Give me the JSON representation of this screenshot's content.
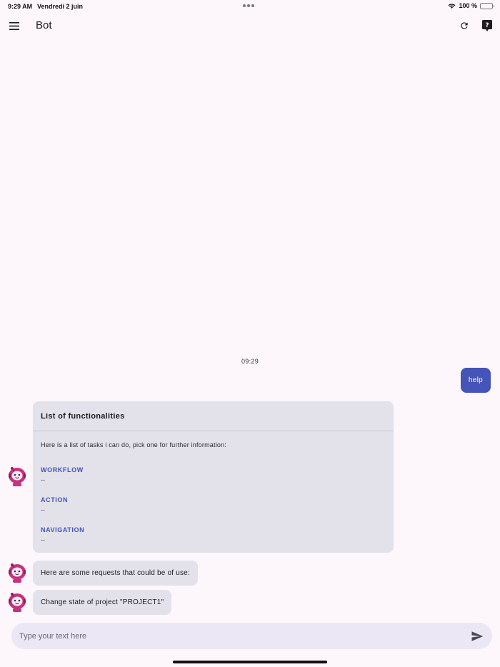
{
  "status_bar": {
    "time": "9:29 AM",
    "date": "Vendredi 2 juin",
    "battery": "100 %"
  },
  "app_bar": {
    "title": "Bot",
    "icons": [
      "menu-icon",
      "refresh-icon",
      "help-icon"
    ]
  },
  "chat": {
    "timestamp": "09:29",
    "user_message": "help",
    "card": {
      "title": "List of functionalities",
      "intro": "Here is a list of tasks i can do, pick one for further information:",
      "items": [
        {
          "name": "WORKFLOW",
          "desc": "--"
        },
        {
          "name": "ACTION",
          "desc": "--"
        },
        {
          "name": "NAVIGATION",
          "desc": "--"
        }
      ]
    },
    "bot_messages": [
      "Here are some requests that could be of use:",
      "Change state of project \"PROJECT1\""
    ]
  },
  "input": {
    "placeholder": "Type your text here",
    "value": ""
  },
  "colors": {
    "background": "#fdf7fc",
    "accent": "#4554b8",
    "bubble": "#e3e1ea",
    "input_bg": "#ebe7f4",
    "avatar": "#c8317f"
  }
}
